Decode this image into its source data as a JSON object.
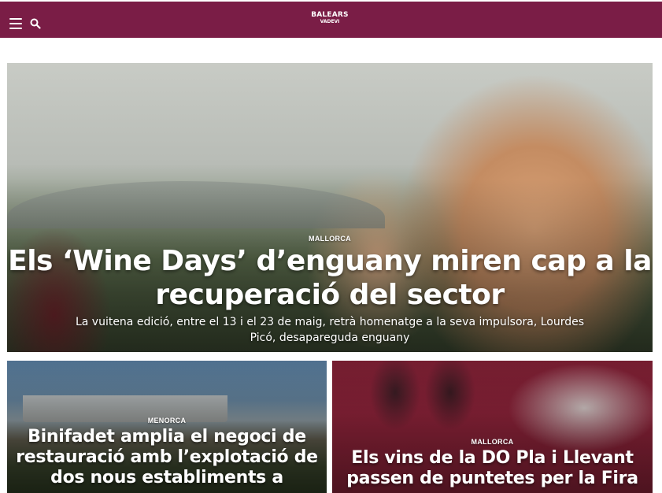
{
  "header": {
    "menu_icon": "hamburger-menu-icon",
    "search_icon": "search-icon",
    "logo_line1": "BALEARS",
    "logo_line2": "VADEVI",
    "background": "#7a1d46"
  },
  "hero": {
    "kicker": "MALLORCA",
    "title": "Els ‘Wine Days’ d’enguany miren cap a la recuperació del sector",
    "lead": "La vuitena edició, entre el 13 i el 23 de maig, retrà homenatge a la seva impulsora, Lourdes Picó, desapareguda enguany"
  },
  "articles": [
    {
      "kicker": "MENORCA",
      "title": "Binifadet amplia el negoci de restauració amb l’explotació de dos nous establiments a"
    },
    {
      "kicker": "MALLORCA",
      "title": "Els vins de la DO Pla i Llevant passen de puntetes per la Fira"
    }
  ]
}
